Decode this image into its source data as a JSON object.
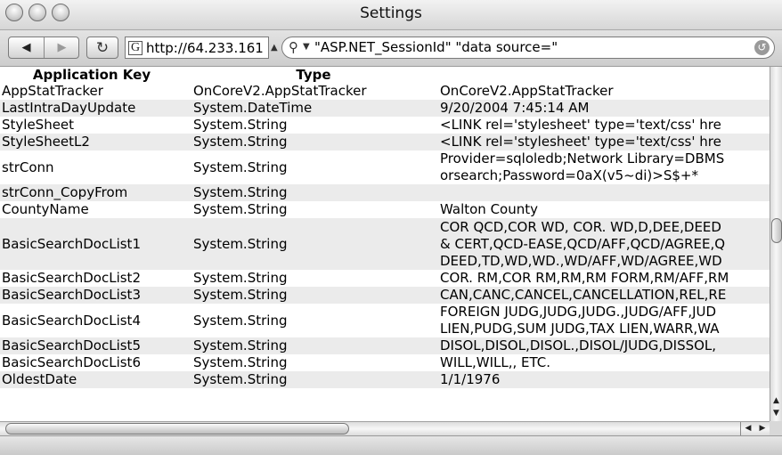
{
  "window": {
    "title": "Settings"
  },
  "toolbar": {
    "back_icon": "back-arrow-icon",
    "forward_icon": "forward-arrow-icon",
    "reload_icon": "reload-icon",
    "favicon_glyph": "G",
    "url": "http://64.233.161",
    "search_query": "\"ASP.NET_SessionId\" \"data source=\""
  },
  "table": {
    "headers": {
      "key": "Application Key",
      "type": "Type",
      "value": ""
    },
    "rows": [
      {
        "key": "AppStatTracker",
        "type": "OnCoreV2.AppStatTracker",
        "value": [
          "OnCoreV2.AppStatTracker"
        ]
      },
      {
        "key": "LastIntraDayUpdate",
        "type": "System.DateTime",
        "value": [
          "9/20/2004 7:45:14 AM"
        ]
      },
      {
        "key": "StyleSheet",
        "type": "System.String",
        "value": [
          "<LINK rel='stylesheet' type='text/css' hre"
        ]
      },
      {
        "key": "StyleSheetL2",
        "type": "System.String",
        "value": [
          "<LINK rel='stylesheet' type='text/css' hre"
        ]
      },
      {
        "key": "strConn",
        "type": "System.String",
        "value": [
          "Provider=sqloledb;Network Library=DBMS",
          "orsearch;Password=0aX(v5~di)>S$+*"
        ]
      },
      {
        "key": "strConn_CopyFrom",
        "type": "System.String",
        "value": [
          ""
        ]
      },
      {
        "key": "CountyName",
        "type": "System.String",
        "value": [
          "Walton County"
        ]
      },
      {
        "key": "BasicSearchDocList1",
        "type": "System.String",
        "value": [
          "COR QCD,COR WD, COR. WD,D,DEE,DEED",
          "& CERT,QCD-EASE,QCD/AFF,QCD/AGREE,Q",
          "DEED,TD,WD,WD.,WD/AFF,WD/AGREE,WD"
        ]
      },
      {
        "key": "BasicSearchDocList2",
        "type": "System.String",
        "value": [
          "COR. RM,COR RM,RM,RM FORM,RM/AFF,RM"
        ]
      },
      {
        "key": "BasicSearchDocList3",
        "type": "System.String",
        "value": [
          "CAN,CANC,CANCEL,CANCELLATION,REL,RE"
        ]
      },
      {
        "key": "BasicSearchDocList4",
        "type": "System.String",
        "value": [
          "FOREIGN JUDG,JUDG,JUDG.,JUDG/AFF,JUD",
          "LIEN,PUDG,SUM JUDG,TAX LIEN,WARR,WA"
        ]
      },
      {
        "key": "BasicSearchDocList5",
        "type": "System.String",
        "value": [
          "DISOL,DISOL,DISOL.,DISOL/JUDG,DISSOL,"
        ]
      },
      {
        "key": "BasicSearchDocList6",
        "type": "System.String",
        "value": [
          "WILL,WILL,, ETC."
        ]
      },
      {
        "key": "OldestDate",
        "type": "System.String",
        "value": [
          "1/1/1976"
        ]
      }
    ]
  }
}
